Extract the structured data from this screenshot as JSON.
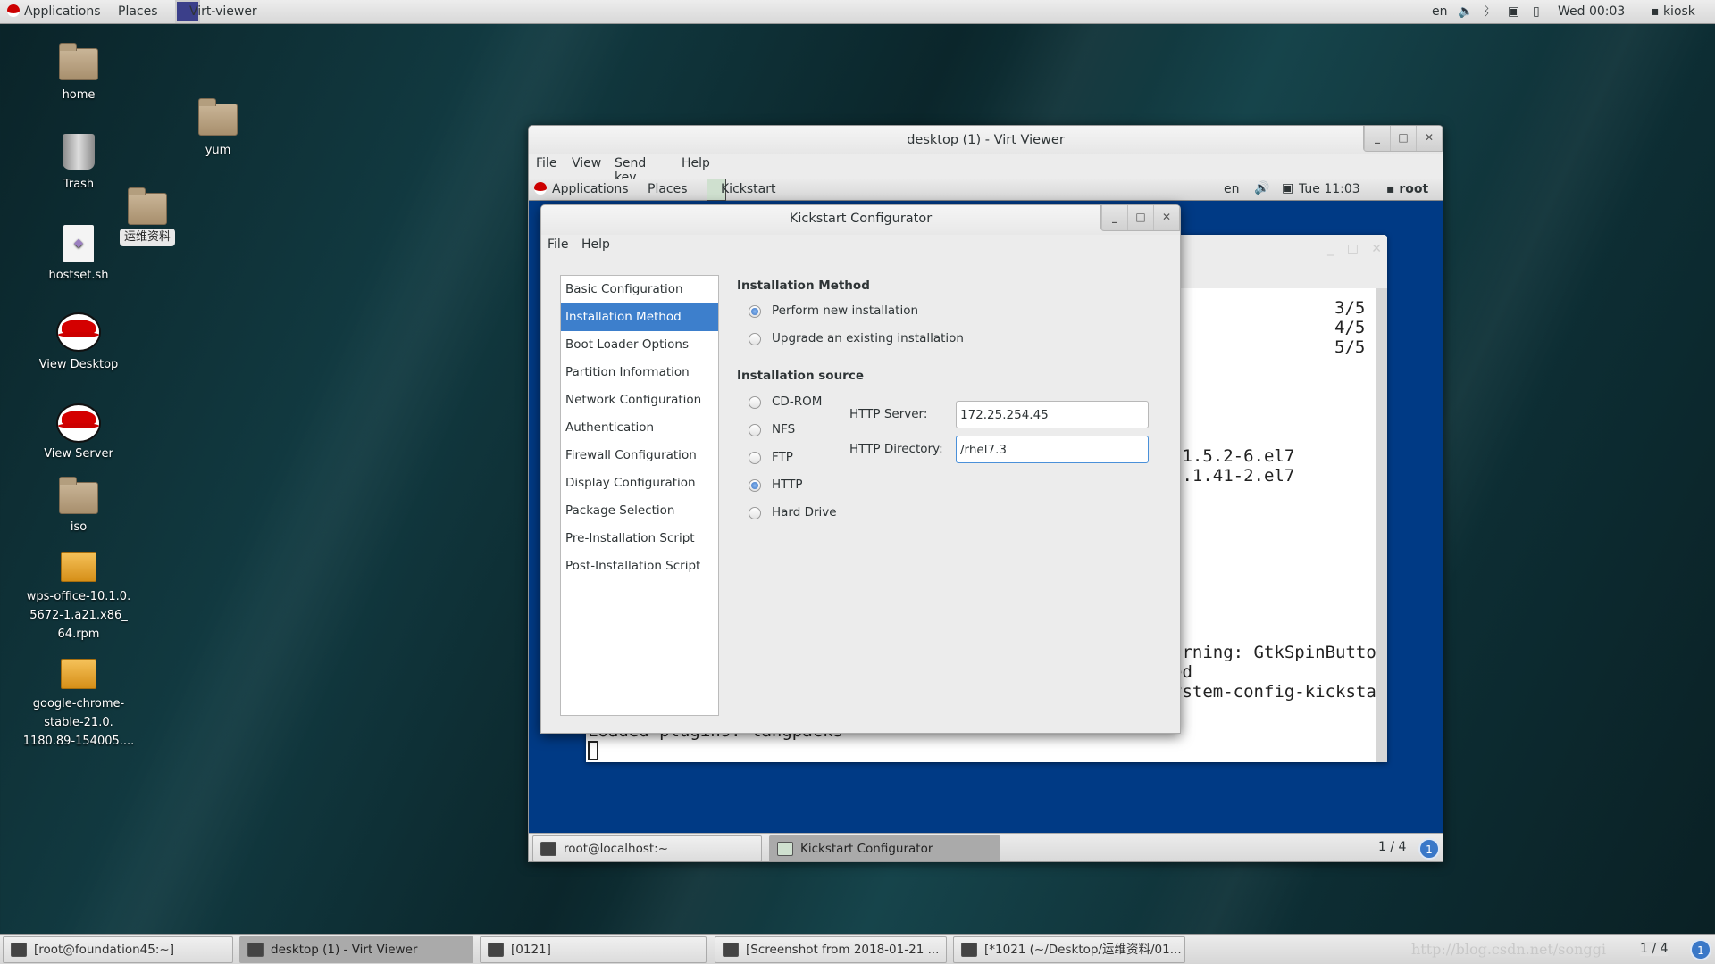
{
  "topbar": {
    "applications": "Applications",
    "places": "Places",
    "app": "Virt-viewer",
    "lang": "en",
    "clock": "Wed 00:03",
    "user": "kiosk"
  },
  "desktop_icons": [
    {
      "label": "home",
      "icon": "home-folder-icon"
    },
    {
      "label": "Trash",
      "icon": "trash-icon"
    },
    {
      "label": "hostset.sh",
      "icon": "script-file-icon"
    },
    {
      "label": "View Desktop",
      "icon": "redhat-icon"
    },
    {
      "label": "View Server",
      "icon": "redhat-icon"
    },
    {
      "label": "iso",
      "icon": "locked-folder-icon"
    },
    {
      "label": "wps-office-10.1.0.\n5672-1.a21.x86_\n64.rpm",
      "icon": "package-icon"
    },
    {
      "label": "google-chrome-\nstable-21.0.\n1180.89-154005....",
      "icon": "package-icon"
    },
    {
      "label": "yum",
      "icon": "folder-icon"
    },
    {
      "label": "运维资料",
      "icon": "folder-icon"
    }
  ],
  "virt_viewer": {
    "title": "desktop (1) - Virt Viewer",
    "menu": [
      "File",
      "View",
      "Send key",
      "Help"
    ]
  },
  "guest": {
    "topbar": {
      "applications": "Applications",
      "places": "Places",
      "app": "Kickstart",
      "lang": "en",
      "clock": "Tue 11:03",
      "user": "root"
    },
    "terminal_lines": {
      "l1": "3/5",
      "l2": "4/5",
      "l3": "5/5",
      "l4": ":1.5.2-6.el7",
      "l5": "2.1.41-2.el7",
      "l6": "arning: GtkSpinButto",
      "l7": "ed",
      "l8": "ystem-config-kicksta",
      "l9": "Loaded plugins: langpacks"
    },
    "taskbar": {
      "items": [
        "root@localhost:~",
        "Kickstart Configurator"
      ],
      "workspace": "1 / 4",
      "badge": "1"
    }
  },
  "kickstart": {
    "title": "Kickstart Configurator",
    "menu": [
      "File",
      "Help"
    ],
    "sidebar": [
      "Basic Configuration",
      "Installation Method",
      "Boot Loader Options",
      "Partition Information",
      "Network Configuration",
      "Authentication",
      "Firewall Configuration",
      "Display Configuration",
      "Package Selection",
      "Pre-Installation Script",
      "Post-Installation Script"
    ],
    "selected": "Installation Method",
    "method_heading": "Installation Method",
    "method_options": [
      {
        "label": "Perform new installation",
        "checked": true
      },
      {
        "label": "Upgrade an existing installation",
        "checked": false
      }
    ],
    "source_heading": "Installation source",
    "source_options": [
      {
        "label": "CD-ROM",
        "checked": false
      },
      {
        "label": "NFS",
        "checked": false
      },
      {
        "label": "FTP",
        "checked": false
      },
      {
        "label": "HTTP",
        "checked": true
      },
      {
        "label": "Hard Drive",
        "checked": false
      }
    ],
    "http_server_label": "HTTP Server:",
    "http_server": "172.25.254.45",
    "http_dir_label": "HTTP Directory:",
    "http_dir": "/rhel7.3"
  },
  "taskbar": {
    "items": [
      "[root@foundation45:~]",
      "desktop (1) - Virt Viewer",
      "[0121]",
      "[Screenshot from 2018-01-21 ...",
      "[*1021 (~/Desktop/运维资料/01..."
    ],
    "active": 1,
    "watermark": "http://blog.csdn.net/songgi",
    "workspace": "1 / 4",
    "badge": "1"
  },
  "colors": {
    "accent": "#3d7fcc",
    "guest_bg": "#003a85"
  }
}
